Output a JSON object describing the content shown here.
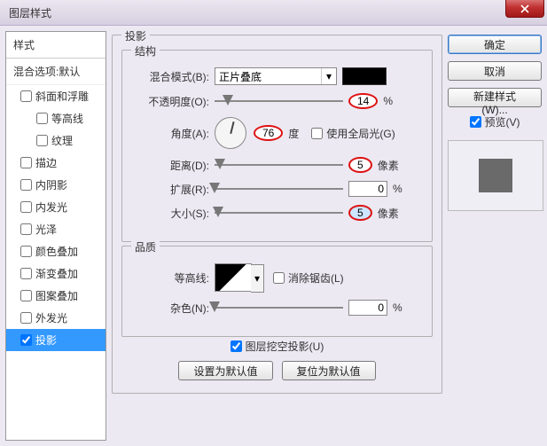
{
  "window": {
    "title": "图层样式"
  },
  "left": {
    "header": "样式",
    "blend_default": "混合选项:默认",
    "items": [
      {
        "label": "斜面和浮雕",
        "checked": false,
        "indent": false
      },
      {
        "label": "等高线",
        "checked": false,
        "indent": true
      },
      {
        "label": "纹理",
        "checked": false,
        "indent": true
      },
      {
        "label": "描边",
        "checked": false,
        "indent": false
      },
      {
        "label": "内阴影",
        "checked": false,
        "indent": false
      },
      {
        "label": "内发光",
        "checked": false,
        "indent": false
      },
      {
        "label": "光泽",
        "checked": false,
        "indent": false
      },
      {
        "label": "颜色叠加",
        "checked": false,
        "indent": false
      },
      {
        "label": "渐变叠加",
        "checked": false,
        "indent": false
      },
      {
        "label": "图案叠加",
        "checked": false,
        "indent": false
      },
      {
        "label": "外发光",
        "checked": false,
        "indent": false
      },
      {
        "label": "投影",
        "checked": true,
        "indent": false,
        "selected": true
      }
    ]
  },
  "center": {
    "title": "投影",
    "structure": {
      "legend": "结构",
      "blend_mode": {
        "label": "混合模式(B):",
        "value": "正片叠底",
        "swatch": "#000000"
      },
      "opacity": {
        "label": "不透明度(O):",
        "value": "14",
        "unit": "%",
        "thumb": 10
      },
      "angle": {
        "label": "角度(A):",
        "value": "76",
        "unit": "度",
        "global_label": "使用全局光(G)",
        "global_checked": false
      },
      "distance": {
        "label": "距离(D):",
        "value": "5",
        "unit": "像素",
        "thumb": 4
      },
      "spread": {
        "label": "扩展(R):",
        "value": "0",
        "unit": "%",
        "thumb": 0
      },
      "size": {
        "label": "大小(S):",
        "value": "5",
        "unit": "像素",
        "thumb": 3,
        "selected": true
      }
    },
    "quality": {
      "legend": "品质",
      "contour": {
        "label": "等高线:",
        "anti_label": "消除锯齿(L)",
        "anti_checked": false
      },
      "noise": {
        "label": "杂色(N):",
        "value": "0",
        "unit": "%",
        "thumb": 0
      }
    },
    "knockout": {
      "label": "图层挖空投影(U)",
      "checked": true
    },
    "buttons": {
      "set_default": "设置为默认值",
      "reset_default": "复位为默认值"
    }
  },
  "right": {
    "ok": "确定",
    "cancel": "取消",
    "new_style": "新建样式(W)...",
    "preview": {
      "label": "预览(V)",
      "checked": true
    }
  }
}
